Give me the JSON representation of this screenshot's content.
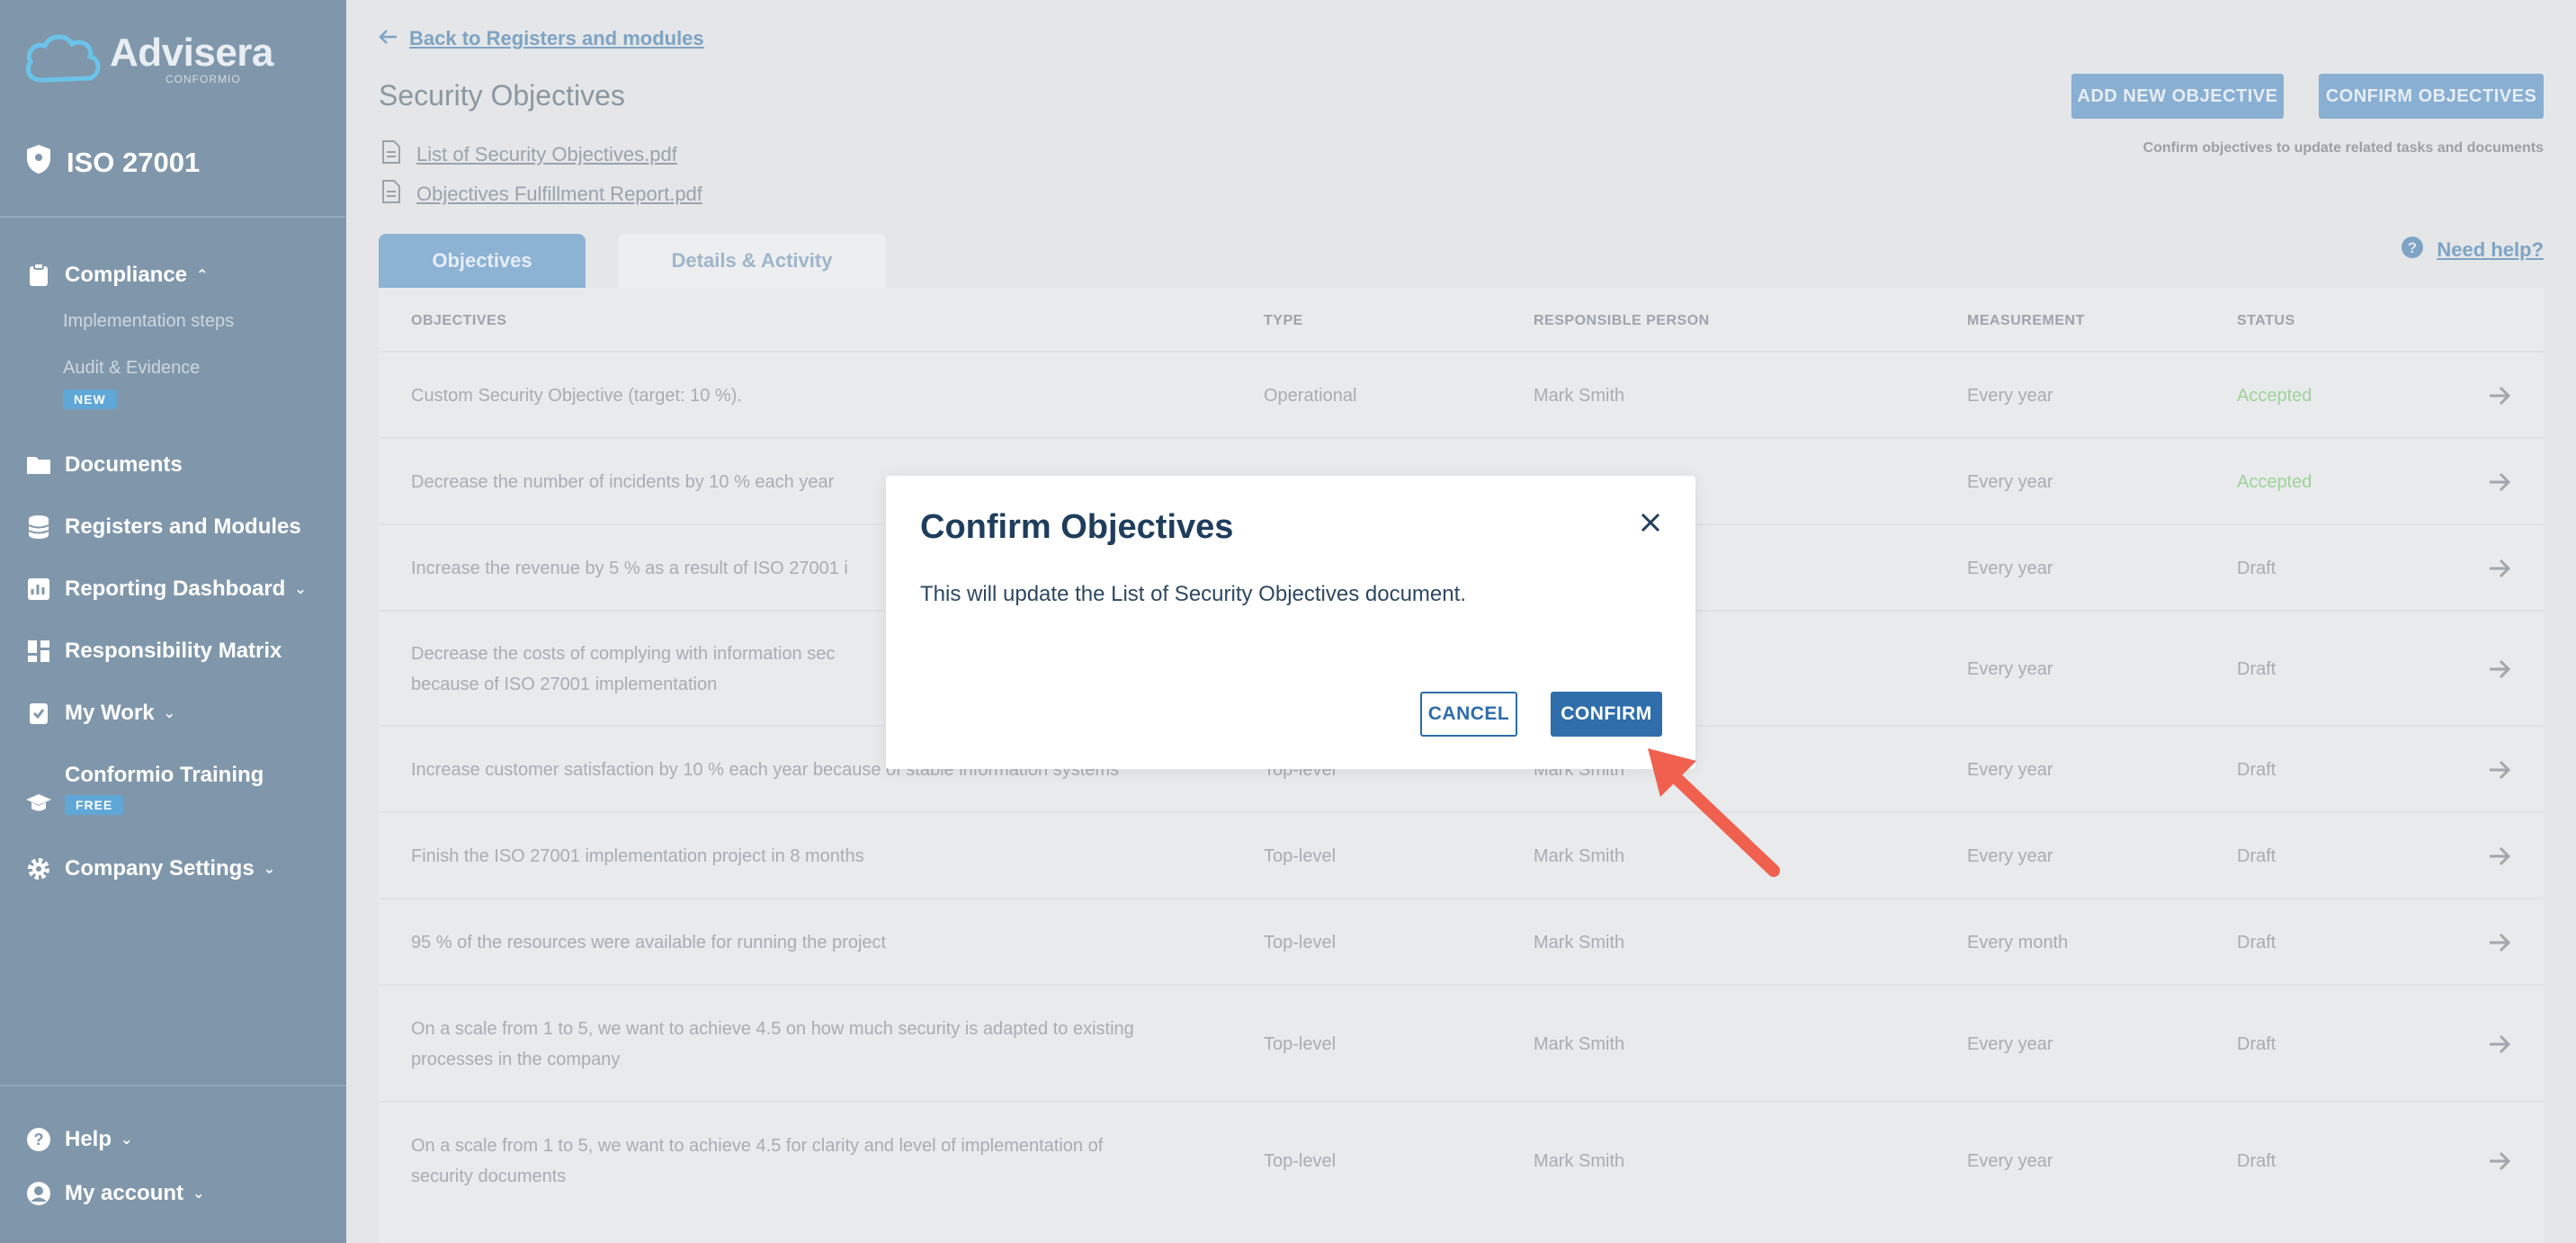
{
  "sidebar": {
    "logo_name": "Advisera",
    "logo_sub": "Conformio",
    "product": "ISO 27001",
    "compliance": "Compliance",
    "implementation_steps": "Implementation steps",
    "audit_evidence": "Audit & Evidence",
    "new_badge": "NEW",
    "documents": "Documents",
    "registers": "Registers and Modules",
    "reporting": "Reporting Dashboard",
    "responsibility": "Responsibility Matrix",
    "my_work": "My Work",
    "training": "Conformio Training",
    "free_badge": "FREE",
    "company_settings": "Company Settings",
    "help": "Help",
    "my_account": "My account"
  },
  "header": {
    "back_link": "Back to Registers and modules",
    "title": "Security Objectives",
    "doc1": "List of Security Objectives.pdf",
    "doc2": "Objectives Fulfillment Report.pdf",
    "add_btn": "ADD NEW OBJECTIVE",
    "confirm_btn": "CONFIRM OBJECTIVES",
    "confirm_hint": "Confirm objectives to update related tasks and documents",
    "need_help": "Need help?"
  },
  "tabs": [
    "Objectives",
    "Details & Activity"
  ],
  "table": {
    "headers": [
      "OBJECTIVES",
      "TYPE",
      "RESPONSIBLE PERSON",
      "MEASUREMENT",
      "STATUS"
    ],
    "rows": [
      {
        "obj": "Custom Security Objective (target: 10 %).",
        "type": "Operational",
        "person": "Mark Smith",
        "meas": "Every year",
        "status": "Accepted"
      },
      {
        "obj": "Decrease the number of incidents by 10 % each year",
        "type": "",
        "person": "",
        "meas": "Every year",
        "status": "Accepted"
      },
      {
        "obj": "Increase the revenue by 5 % as a result of ISO 27001 i",
        "type": "",
        "person": "",
        "meas": "Every year",
        "status": "Draft"
      },
      {
        "obj": "Decrease the costs of complying with information sec\nbecause of ISO 27001 implementation",
        "type": "",
        "person": "",
        "meas": "Every year",
        "status": "Draft"
      },
      {
        "obj": "Increase customer satisfaction by 10 % each year because of stable information systems",
        "type": "Top-level",
        "person": "Mark Smith",
        "meas": "Every year",
        "status": "Draft"
      },
      {
        "obj": "Finish the ISO 27001 implementation project in 8 months",
        "type": "Top-level",
        "person": "Mark Smith",
        "meas": "Every year",
        "status": "Draft"
      },
      {
        "obj": "95 % of the resources were available for running the project",
        "type": "Top-level",
        "person": "Mark Smith",
        "meas": "Every month",
        "status": "Draft"
      },
      {
        "obj": "On a scale from 1 to 5, we want to achieve 4.5 on how much security is adapted to existing\nprocesses in the company",
        "type": "Top-level",
        "person": "Mark Smith",
        "meas": "Every year",
        "status": "Draft"
      },
      {
        "obj": "On a scale from 1 to 5, we want to achieve 4.5 for clarity and level of implementation of\nsecurity documents",
        "type": "Top-level",
        "person": "Mark Smith",
        "meas": "Every year",
        "status": "Draft"
      }
    ]
  },
  "modal": {
    "title": "Confirm Objectives",
    "body": "This will update the List of Security Objectives document.",
    "cancel": "CANCEL",
    "confirm": "CONFIRM"
  },
  "colors": {
    "sidebar": "#8097ab",
    "primary": "#2f6eab",
    "modal_title": "#1f3d5c",
    "pointer": "#f0604f"
  }
}
